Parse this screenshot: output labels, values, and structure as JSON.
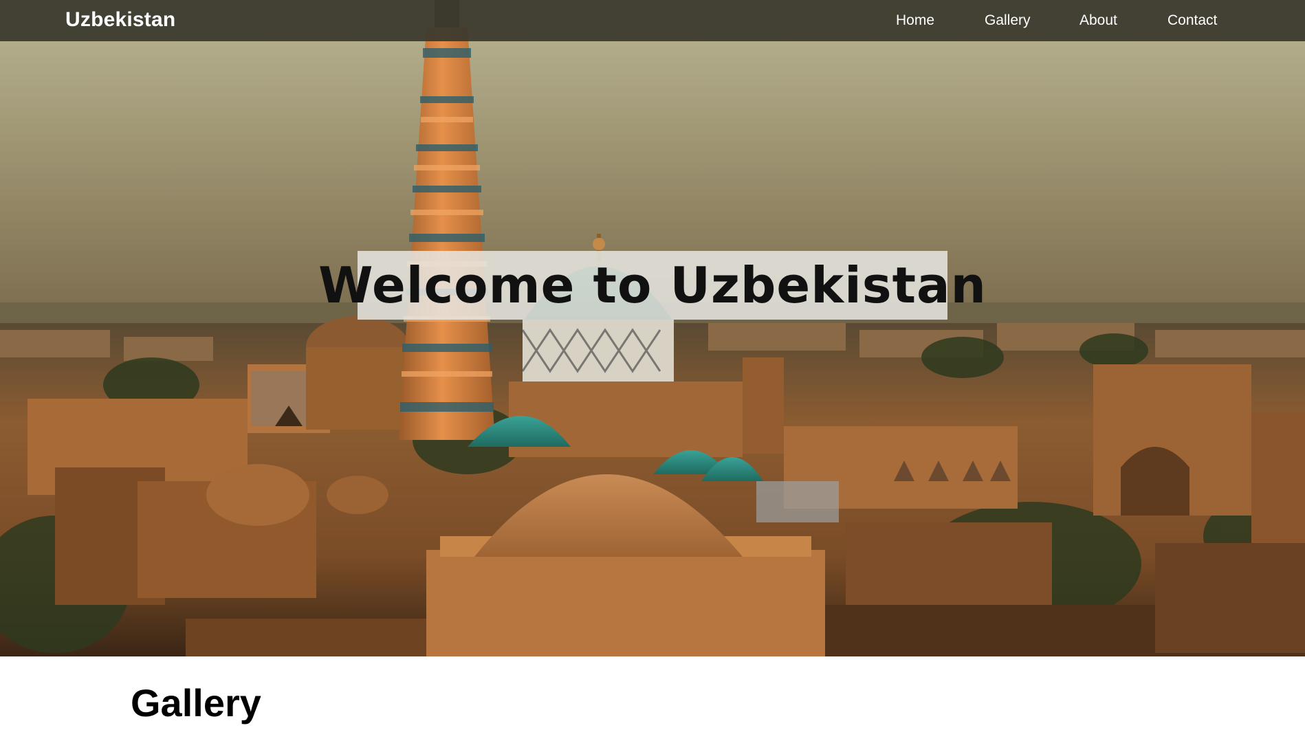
{
  "navbar": {
    "brand": "Uzbekistan",
    "links": [
      {
        "label": "Home"
      },
      {
        "label": "Gallery"
      },
      {
        "label": "About"
      },
      {
        "label": "Contact"
      }
    ]
  },
  "hero": {
    "heading": "Welcome to Uzbekistan",
    "image": "city-skyline-with-minaret-and-domes-photo"
  },
  "gallery": {
    "title": "Gallery"
  },
  "colors": {
    "navbar_bg": "#3a382d",
    "nav_text": "#ffffff",
    "welcome_box_bg": "#e8e6e2",
    "dome_teal": "#2f8a7e",
    "brick": "#b9763f"
  }
}
